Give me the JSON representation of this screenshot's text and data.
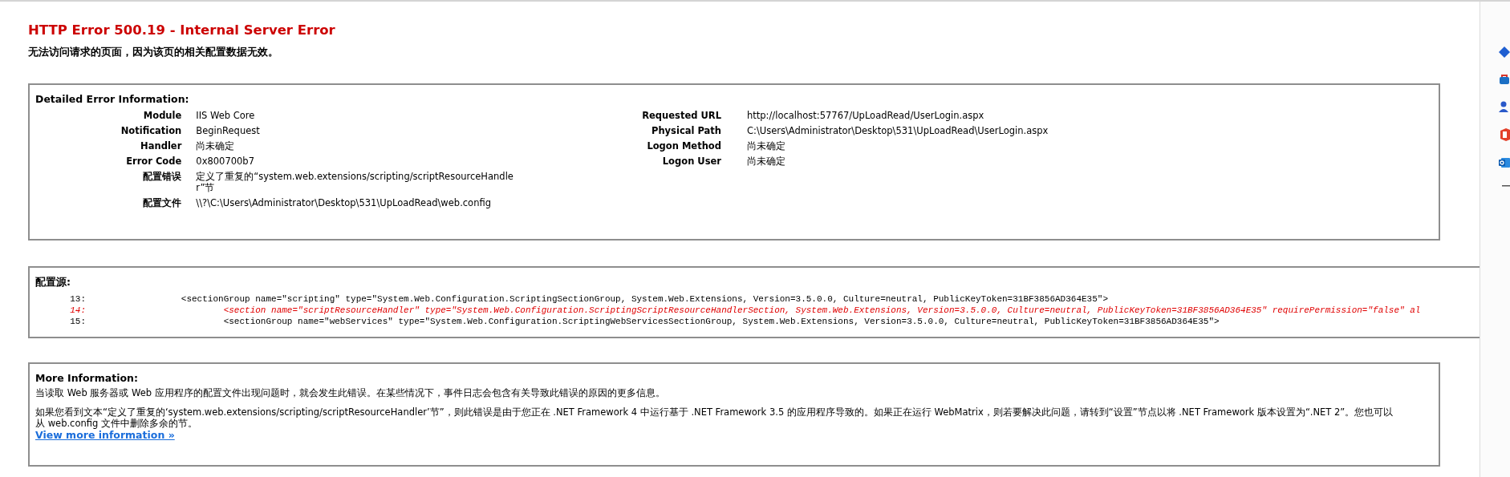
{
  "title": "HTTP Error 500.19 - Internal Server Error",
  "subtitle": "无法访问请求的页面，因为该页的相关配置数据无效。",
  "detail": {
    "heading": "Detailed Error Information:",
    "left": [
      {
        "label": "Module",
        "value": "IIS Web Core"
      },
      {
        "label": "Notification",
        "value": "BeginRequest"
      },
      {
        "label": "Handler",
        "value": "尚未确定"
      },
      {
        "label": "Error Code",
        "value": "0x800700b7"
      },
      {
        "label": "配置错误",
        "value": "定义了重复的“system.web.extensions/scripting/scriptResourceHandler”节"
      },
      {
        "label": "配置文件",
        "value": "\\\\?\\C:\\Users\\Administrator\\Desktop\\531\\UpLoadRead\\web.config"
      }
    ],
    "right": [
      {
        "label": "Requested URL",
        "value": "http://localhost:57767/UpLoadRead/UserLogin.aspx"
      },
      {
        "label": "Physical Path",
        "value": "C:\\Users\\Administrator\\Desktop\\531\\UpLoadRead\\UserLogin.aspx"
      },
      {
        "label": "Logon Method",
        "value": "尚未确定"
      },
      {
        "label": "Logon User",
        "value": "尚未确定"
      }
    ]
  },
  "config_source": {
    "heading": "配置源:",
    "lines": [
      {
        "number": "13:",
        "code": "                  <sectionGroup name=\"scripting\" type=\"System.Web.Configuration.ScriptingSectionGroup, System.Web.Extensions, Version=3.5.0.0, Culture=neutral, PublicKeyToken=31BF3856AD364E35\">",
        "highlighted": false
      },
      {
        "number": "14:",
        "code": "                          <section name=\"scriptResourceHandler\" type=\"System.Web.Configuration.ScriptingScriptResourceHandlerSection, System.Web.Extensions, Version=3.5.0.0, Culture=neutral, PublicKeyToken=31BF3856AD364E35\" requirePermission=\"false\" al",
        "highlighted": true
      },
      {
        "number": "15:",
        "code": "                          <sectionGroup name=\"webServices\" type=\"System.Web.Configuration.ScriptingWebServicesSectionGroup, System.Web.Extensions, Version=3.5.0.0, Culture=neutral, PublicKeyToken=31BF3856AD364E35\">",
        "highlighted": false
      }
    ]
  },
  "more_info": {
    "heading": "More Information:",
    "paragraphs": [
      "当读取 Web 服务器或 Web 应用程序的配置文件出现问题时，就会发生此错误。在某些情况下，事件日志会包含有关导致此错误的原因的更多信息。",
      "如果您看到文本“定义了重复的‘system.web.extensions/scripting/scriptResourceHandler’节”，则此错误是由于您正在 .NET Framework 4 中运行基于 .NET Framework 3.5 的应用程序导致的。如果正在运行 WebMatrix，则若要解决此问题，请转到“设置”节点以将 .NET Framework 版本设置为“.NET 2”。您也可以从 web.config 文件中删除多余的节。"
    ],
    "link": "View more information »"
  }
}
